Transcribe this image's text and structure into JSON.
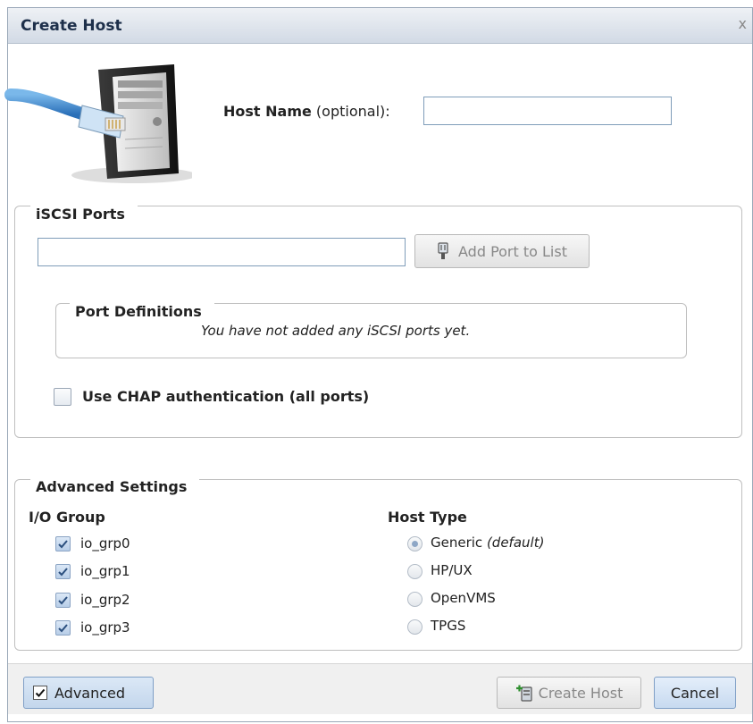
{
  "dialog": {
    "title": "Create Host",
    "close_label": "x"
  },
  "host": {
    "label_bold": "Host Name",
    "label_rest": " (optional):",
    "value": ""
  },
  "iscsi": {
    "legend": "iSCSI Ports",
    "port_value": "",
    "add_port_label": "Add Port to List",
    "port_definitions_legend": "Port Definitions",
    "port_definitions_message": "You have not added any iSCSI ports yet.",
    "chap_label": "Use CHAP authentication (all ports)",
    "chap_checked": false
  },
  "advanced": {
    "legend": "Advanced Settings",
    "io_group_heading": "I/O Group",
    "io_groups": [
      {
        "label": "io_grp0",
        "checked": true
      },
      {
        "label": "io_grp1",
        "checked": true
      },
      {
        "label": "io_grp2",
        "checked": true
      },
      {
        "label": "io_grp3",
        "checked": true
      }
    ],
    "host_type_heading": "Host Type",
    "host_types": [
      {
        "label": "Generic",
        "suffix": "(default)",
        "selected": true
      },
      {
        "label": "HP/UX",
        "suffix": "",
        "selected": false
      },
      {
        "label": "OpenVMS",
        "suffix": "",
        "selected": false
      },
      {
        "label": "TPGS",
        "suffix": "",
        "selected": false
      }
    ]
  },
  "footer": {
    "advanced_label": "Advanced",
    "advanced_checked": true,
    "create_host_label": "Create Host",
    "cancel_label": "Cancel"
  },
  "colors": {
    "titlebar": "#d2dae5",
    "accent_button": "#c7daf0"
  },
  "icons": [
    "server-cable-icon",
    "port-plug-icon",
    "create-host-icon",
    "checkmark-icon"
  ]
}
